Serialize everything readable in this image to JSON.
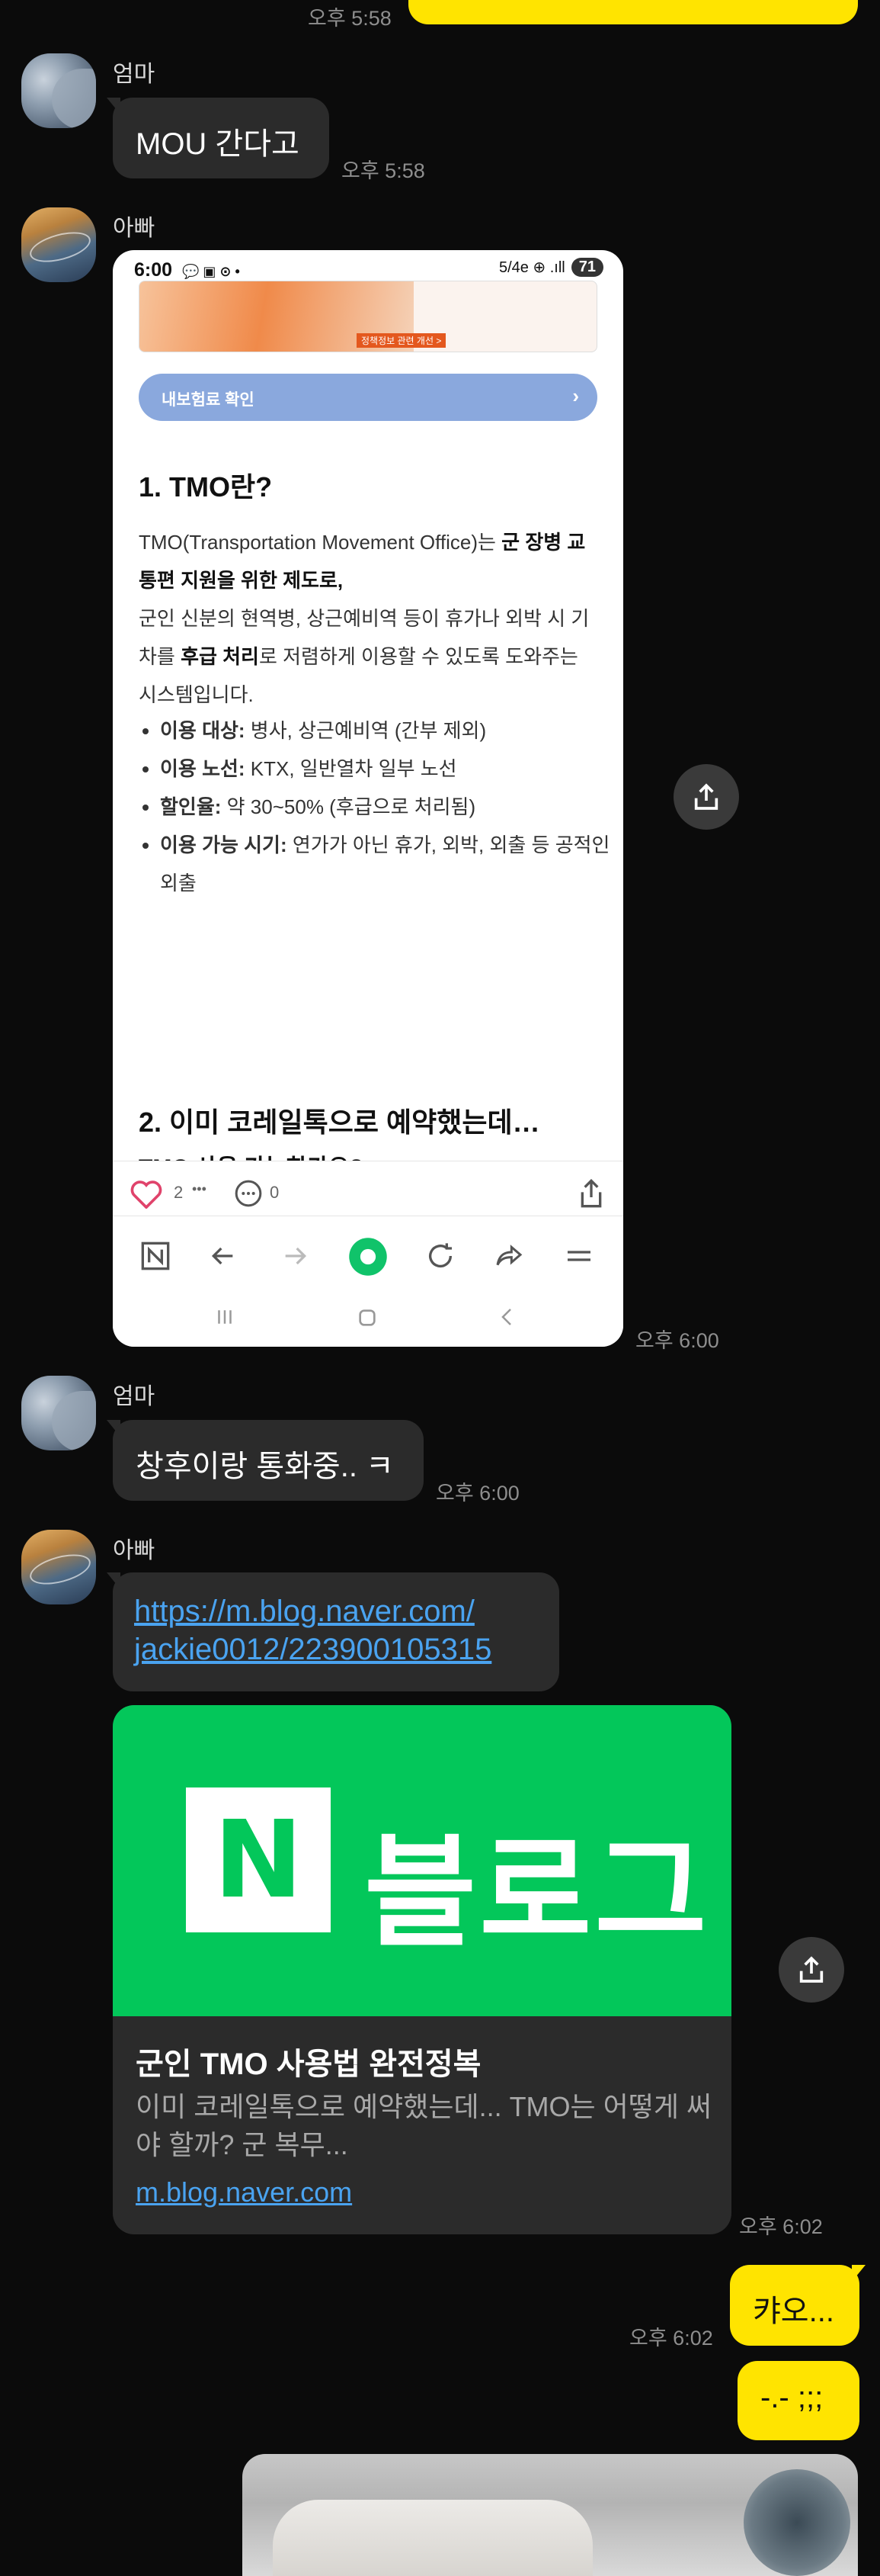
{
  "messages": {
    "top_time": "오후 5:58",
    "mom1": {
      "sender": "엄마",
      "text": "MOU 간다고",
      "time": "오후 5:58"
    },
    "dad1": {
      "sender": "아빠",
      "time": "오후 6:00"
    },
    "mom2": {
      "sender": "엄마",
      "text": "창후이랑 통화중.. ㅋ",
      "time": "오후 6:00"
    },
    "dad2": {
      "sender": "아빠",
      "link_line1": "https://m.blog.naver.com/",
      "link_line2": "jackie0012/223900105315",
      "time": "오후 6:02"
    },
    "me1": {
      "text": "캬오...",
      "time": "오후 6:02"
    },
    "me2": {
      "text": "-.- ;;;"
    }
  },
  "screenshot": {
    "status_time": "6:00",
    "status_icons": "💬 ▣ ⊙ •",
    "status_right": "5/4e ⊕ .ıll",
    "battery": "71",
    "thumb_label": "정책정보 관련 개선 >",
    "button_label": "내보험료 확인",
    "button_chevron": "›",
    "heading1": "1. TMO란?",
    "para_line1a": "TMO(Transportation Movement Office)는 ",
    "para_line1b": "군 장병 교통편 지원을 위한 제도로,",
    "para_line2": "군인 신분의 현역병, 상근예비역 등이 휴가나 외박 시 기차를 ",
    "para_line2b": "후급 처리",
    "para_line2c": "로 저렴하게 이용할 수 있도록 도와주는 시스템입니다.",
    "bullets": [
      {
        "label": "이용 대상:",
        "text": " 병사, 상근예비역 (간부 제외)"
      },
      {
        "label": "이용 노선:",
        "text": " KTX, 일반열차 일부 노선"
      },
      {
        "label": "할인율:",
        "text": " 약 30~50% (후급으로 처리됨)"
      },
      {
        "label": "이용 가능 시기:",
        "text": " 연가가 아닌 휴가, 외박, 외출 등 공적인 외출"
      }
    ],
    "heading2": "2. 이미 코레일톡으로 예약했는데…",
    "heading2_cut": "TMO 사용 가능한가요?",
    "like_count": "2",
    "like_dots": "•••",
    "comment_count": "0"
  },
  "link_card": {
    "brand": "블로그",
    "brand_n": "N",
    "title": "군인 TMO 사용법 완전정복",
    "description": "이미 코레일톡으로 예약했는데... TMO는 어떻게 써야 할까? 군 복무...",
    "url": "m.blog.naver.com"
  },
  "colors": {
    "background": "#0b0b0b",
    "incoming_bubble": "#2b2b2b",
    "outgoing_bubble": "#ffe400",
    "naver_green": "#03c75a",
    "link_blue": "#4aa3f0"
  },
  "icons": [
    "share-icon",
    "heart-icon",
    "comment-icon",
    "naver-n-icon",
    "back-arrow-icon",
    "forward-arrow-icon",
    "home-dot-icon",
    "refresh-icon",
    "share-arrow-icon",
    "menu-icon"
  ]
}
